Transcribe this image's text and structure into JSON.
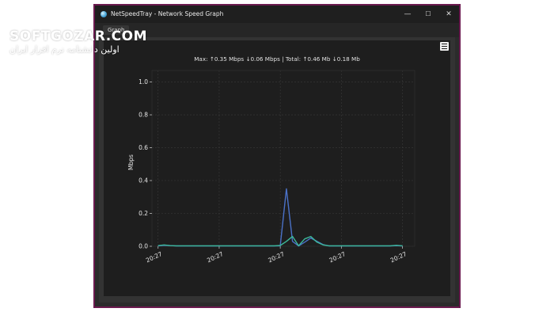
{
  "window": {
    "title": "NetSpeedTray - Network Speed Graph",
    "minimize_glyph": "—",
    "maximize_glyph": "☐",
    "close_glyph": "✕"
  },
  "tabs": [
    {
      "label": "Graph",
      "active": true
    }
  ],
  "stats_line": "Max: ↑0.35 Mbps ↓0.06 Mbps | Total: ↑0.46 Mb ↓0.18 Mb",
  "menu_icon": "hamburger-menu-icon",
  "watermark": {
    "brand": "SOFTGOZAR.COM",
    "tagline": "اولین دانشنامه نرم افزار ایران"
  },
  "colors": {
    "upload": "#4b72c8",
    "download": "#3cb89a",
    "plot_bg": "#1e1e1e",
    "window_border": "#6b1a4f"
  },
  "chart_data": {
    "type": "line",
    "ylabel": "Mbps",
    "xlabel": "",
    "ylim": [
      0,
      1.07
    ],
    "yticks": [
      0.0,
      0.2,
      0.4,
      0.6,
      0.8,
      1.0
    ],
    "xticks": [
      0,
      10,
      20,
      30,
      40
    ],
    "xtick_labels": [
      "20:27",
      "20:27",
      "20:27",
      "20:27",
      "20:27"
    ],
    "xlim": [
      -1,
      42
    ],
    "grid": true,
    "series": [
      {
        "color": "#4b72c8",
        "x": [
          0,
          1,
          2,
          3,
          4,
          5,
          6,
          7,
          8,
          9,
          10,
          11,
          12,
          13,
          14,
          15,
          16,
          17,
          18,
          19,
          20,
          21,
          22,
          23,
          24,
          25,
          26,
          27,
          28,
          29,
          30,
          31,
          32,
          33,
          34,
          35,
          36,
          37,
          38,
          39,
          40
        ],
        "values": [
          0.003,
          0.006,
          0.004,
          0.002,
          0.002,
          0.002,
          0.002,
          0.002,
          0.002,
          0.002,
          0.002,
          0.002,
          0.002,
          0.002,
          0.002,
          0.002,
          0.002,
          0.002,
          0.002,
          0.002,
          0.003,
          0.35,
          0.03,
          0.002,
          0.025,
          0.05,
          0.03,
          0.01,
          0.002,
          0.002,
          0.002,
          0.002,
          0.002,
          0.002,
          0.002,
          0.002,
          0.002,
          0.002,
          0.002,
          0.004,
          0.002
        ]
      },
      {
        "color": "#3cb89a",
        "x": [
          0,
          1,
          2,
          3,
          4,
          5,
          6,
          7,
          8,
          9,
          10,
          11,
          12,
          13,
          14,
          15,
          16,
          17,
          18,
          19,
          20,
          21,
          22,
          23,
          24,
          25,
          26,
          27,
          28,
          29,
          30,
          31,
          32,
          33,
          34,
          35,
          36,
          37,
          38,
          39,
          40
        ],
        "values": [
          0.004,
          0.008,
          0.004,
          0.003,
          0.003,
          0.003,
          0.003,
          0.003,
          0.003,
          0.003,
          0.003,
          0.003,
          0.003,
          0.003,
          0.003,
          0.003,
          0.003,
          0.003,
          0.003,
          0.003,
          0.005,
          0.03,
          0.06,
          0.003,
          0.045,
          0.06,
          0.025,
          0.008,
          0.003,
          0.003,
          0.003,
          0.003,
          0.003,
          0.003,
          0.003,
          0.003,
          0.003,
          0.003,
          0.003,
          0.006,
          0.003
        ]
      }
    ]
  }
}
